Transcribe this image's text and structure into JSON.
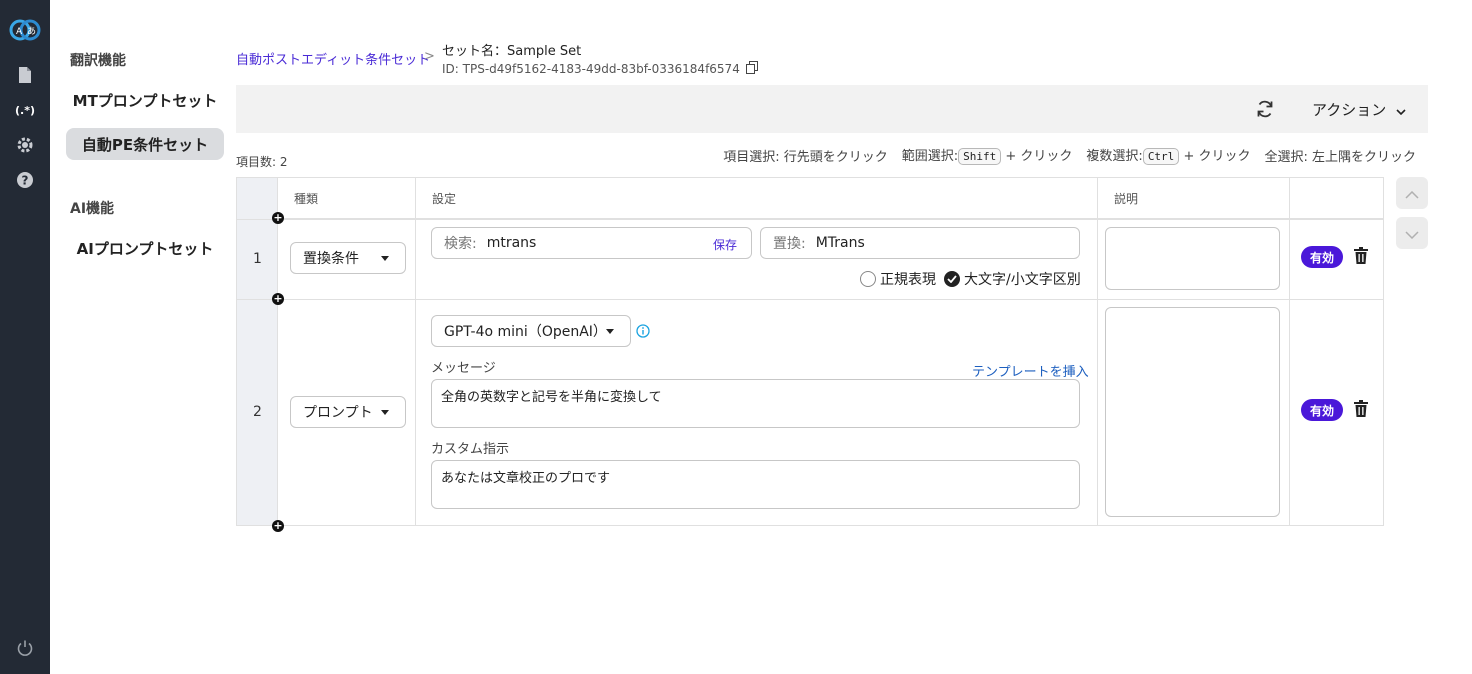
{
  "rail": {
    "icons": [
      "app-logo-icon",
      "document-icon",
      "regex-icon",
      "gear-icon",
      "help-icon",
      "power-icon"
    ],
    "regex_glyph": "(.*)"
  },
  "nav": {
    "section1": "翻訳機能",
    "item_mt": "MTプロンプトセット",
    "item_pe": "自動PE条件セット",
    "section2": "AI機能",
    "item_ai": "AIプロンプトセット"
  },
  "breadcrumb": {
    "link": "自動ポストエディット条件セット",
    "separator": ">",
    "set_name": "セット名：Sample Set",
    "set_id": "ID: TPS-d49f5162-4183-49dd-83bf-0336184f6574"
  },
  "toolbar": {
    "action_label": "アクション"
  },
  "count_label": "項目数: 2",
  "hints": {
    "item_select": "項目選択: 行先頭をクリック",
    "range_label": "範囲選択:",
    "range_key": "Shift",
    "range_suffix": "+ クリック",
    "multi_label": "複数選択:",
    "multi_key": "Ctrl",
    "multi_suffix": "+ クリック",
    "all_select": "全選択: 左上隅をクリック"
  },
  "table": {
    "headers": {
      "type": "種類",
      "settings": "設定",
      "description": "説明"
    },
    "rows": [
      {
        "num": "1",
        "type": "置換条件",
        "search_label": "検索:",
        "search_value": "mtrans",
        "save_label": "保存",
        "replace_label": "置換:",
        "replace_value": "MTrans",
        "regex_label": "正規表現",
        "case_label": "大文字/小文字区別",
        "status": "有効"
      },
      {
        "num": "2",
        "type": "プロンプト",
        "model": "GPT-4o mini（OpenAI）",
        "message_label": "メッセージ",
        "template_link": "テンプレートを挿入",
        "message_value": "全角の英数字と記号を半角に変換して",
        "custom_label": "カスタム指示",
        "custom_value": "あなたは文章校正のプロです",
        "status": "有効"
      }
    ]
  },
  "colors": {
    "accent": "#4a18d9",
    "link": "#4a2bd6",
    "rail": "#232a35"
  }
}
